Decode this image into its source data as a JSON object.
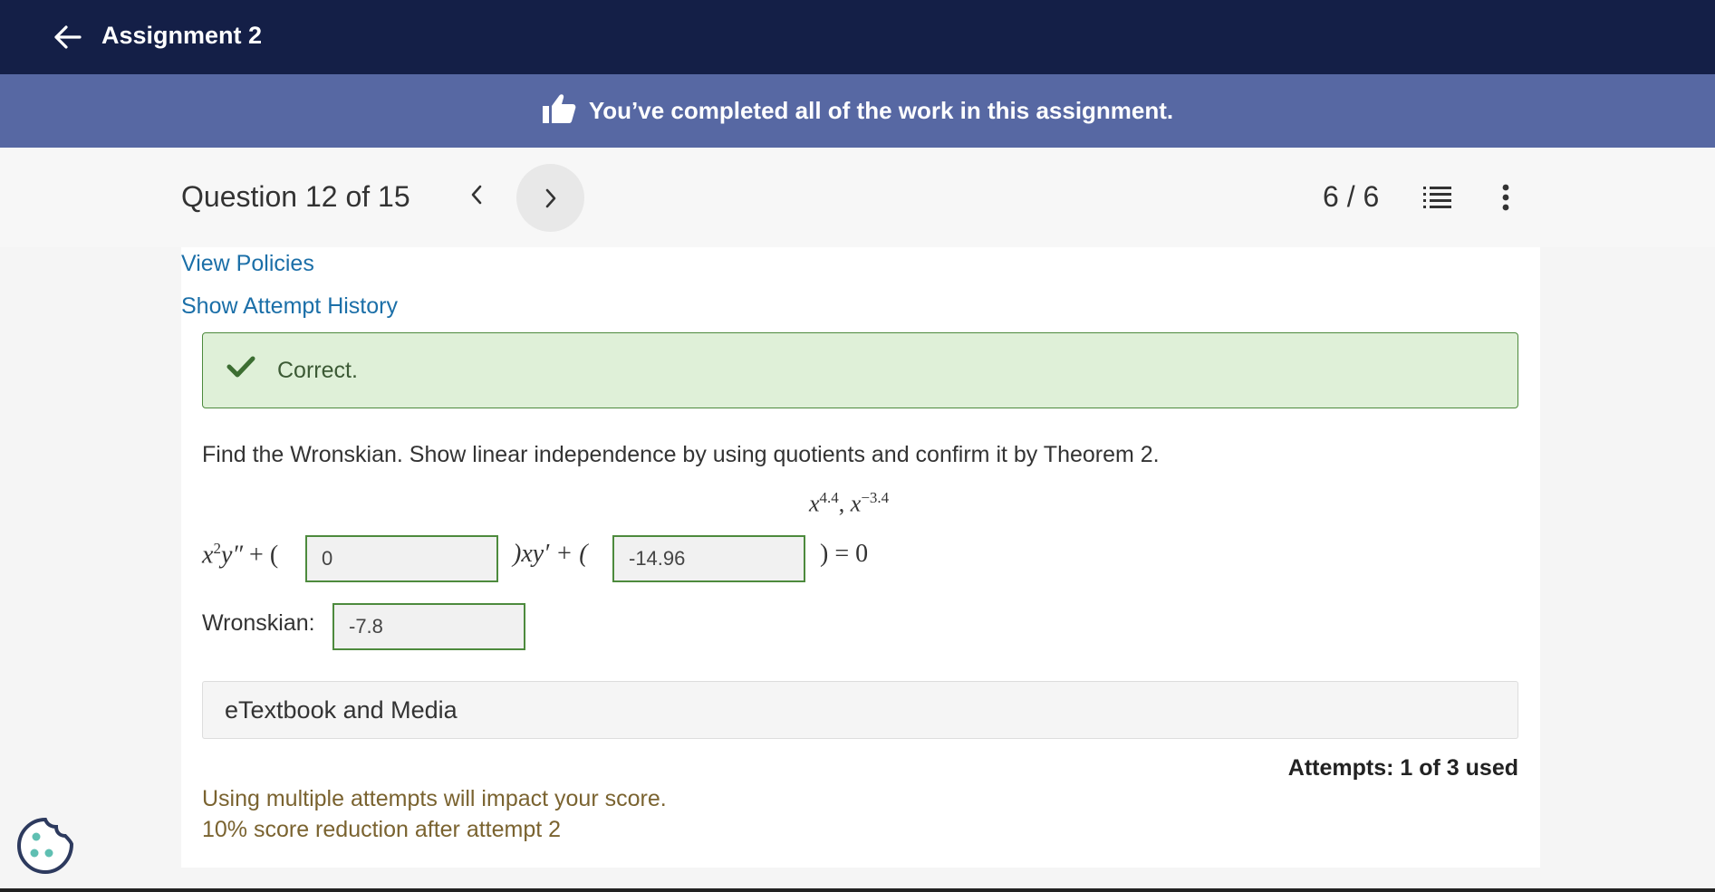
{
  "header": {
    "title": "Assignment 2"
  },
  "banner": {
    "text": "You’ve completed all of the work in this assignment.",
    "icon": "thumbs-up-icon"
  },
  "question_nav": {
    "label": "Question 12 of 15",
    "score": "6 / 6"
  },
  "links": {
    "view_policies": "View Policies",
    "attempt_history": "Show Attempt History"
  },
  "feedback": {
    "status": "Correct."
  },
  "question": {
    "prompt": "Find the Wronskian. Show linear independence by using quotients and confirm it by Theorem 2.",
    "f1_base": "x",
    "f1_exp": "4.4",
    "separator": ", ",
    "f2_base": "x",
    "f2_exp": "−3.4",
    "eq_part1_base": "x",
    "eq_part1_exp": "2",
    "eq_part1_y": "y″",
    "eq_open1": " + (",
    "eq_middle": ")xy′ + (",
    "eq_end": ") = 0",
    "answer1": "0",
    "answer2": "-14.96",
    "wronskian_label": "Wronskian:",
    "wronskian_value": "-7.8"
  },
  "etextbook": {
    "label": "eTextbook and Media"
  },
  "attempts": {
    "label": "Attempts: 1 of 3 used"
  },
  "warning": {
    "line1": "Using multiple attempts will impact your score.",
    "line2": "10% score reduction after attempt 2"
  },
  "colors": {
    "topbar": "#141f47",
    "banner": "#5768a3",
    "link": "#1b6fa8",
    "correct_bg": "#dff0d8",
    "correct_border": "#4d8a3d",
    "warning_text": "#7a6330"
  }
}
